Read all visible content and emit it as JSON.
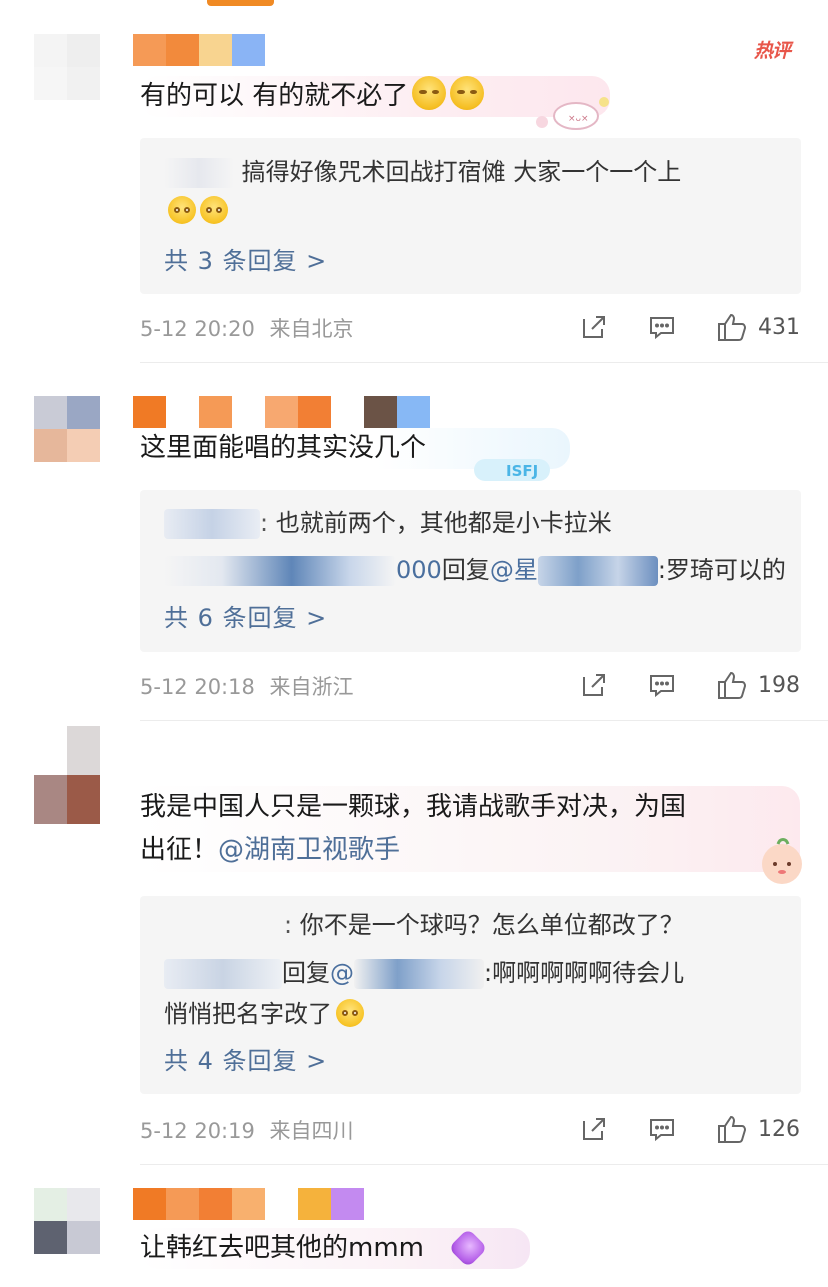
{
  "hot_label": "热评",
  "more_suffix": ">",
  "comments": [
    {
      "body": "有的可以 有的就不必了",
      "replies": [
        {
          "text": "搞得好像咒术回战打宿傩 大家一个一个上"
        }
      ],
      "more": "共 3 条回复 >",
      "time": "5-12 20:20",
      "location": "来自北京",
      "likes": "431"
    },
    {
      "body": "这里面能唱的其实没几个",
      "replies": [
        {
          "text": "也就前两个，其他都是小卡拉米"
        },
        {
          "prefix": "000",
          "verb": "回复",
          "at": "@星",
          "text": ":罗琦可以的"
        }
      ],
      "more": "共 6 条回复 >",
      "time": "5-12 20:18",
      "location": "来自浙江",
      "likes": "198"
    },
    {
      "body_line1": "我是中国人只是一颗球，我请战歌手对决，为国",
      "body_line2": "出征！",
      "mention": "@湖南卫视歌手",
      "replies": [
        {
          "text": "你不是一个球吗？怎么单位都改了？"
        },
        {
          "verb": "回复",
          "at": "@",
          "text": ":啊啊啊啊啊待会儿"
        },
        {
          "text": "悄悄把名字改了"
        }
      ],
      "more": "共 4 条回复 >",
      "time": "5-12 20:19",
      "location": "来自四川",
      "likes": "126"
    },
    {
      "body": "让韩红去吧其他的mmm"
    }
  ],
  "colors": {
    "accent": "#f08a24",
    "link": "#4f6f98",
    "hot": "#e8564a",
    "reply_bg": "#f5f5f5",
    "meta": "#999999"
  }
}
